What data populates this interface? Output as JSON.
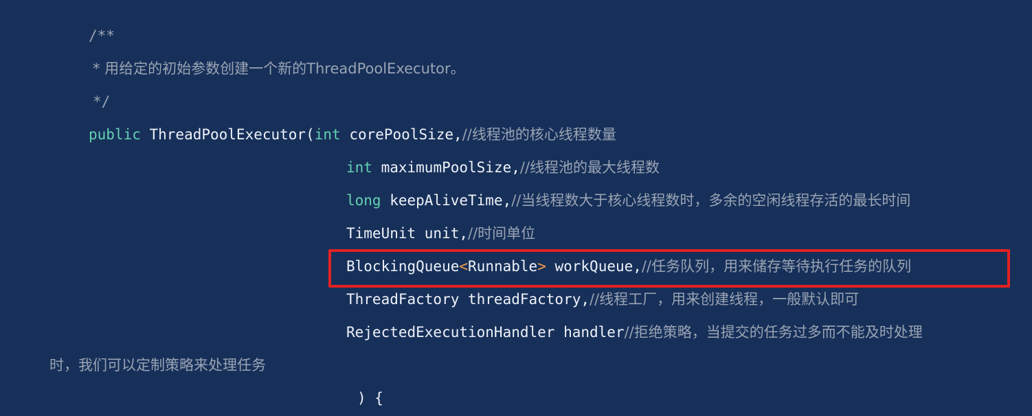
{
  "code": {
    "doc_open": "/**",
    "doc_line": " * 用给定的初始参数创建一个新的ThreadPoolExecutor。",
    "doc_close": " */",
    "kw_public": "public",
    "ctor_name": " ThreadPoolExecutor(",
    "kw_int": "int",
    "p1_name": " corePoolSize,",
    "p1_comment": "//线程池的核心线程数量",
    "kw_int2": "int",
    "p2_name": " maximumPoolSize,",
    "p2_comment": "//线程池的最大线程数",
    "kw_long": "long",
    "p3_name": " keepAliveTime,",
    "p3_comment": "//当线程数大于核心线程数时，多余的空闲线程存活的最长时间",
    "p4_name": "TimeUnit unit,",
    "p4_comment": "//时间单位",
    "p5_type": "BlockingQueue",
    "p5_lt": "<",
    "p5_generic": "Runnable",
    "p5_gt": ">",
    "p5_name": " workQueue,",
    "p5_comment": "//任务队列，用来储存等待执行任务的队列",
    "p6_name": "ThreadFactory threadFactory,",
    "p6_comment": "//线程工厂，用来创建线程，一般默认即可",
    "p7_name": "RejectedExecutionHandler handler",
    "p7_comment": "//拒绝策略，当提交的任务过多而不能及时处理",
    "p7_comment_wrap": "时，我们可以定制策略来处理任务",
    "close_paren": ") {"
  },
  "colors": {
    "background": "#17305a",
    "comment": "#9aa4b3",
    "keyword": "#63d1b2",
    "text": "#eef2f8",
    "generic_bracket": "#f6a04d",
    "highlight_box": "#e32222"
  }
}
